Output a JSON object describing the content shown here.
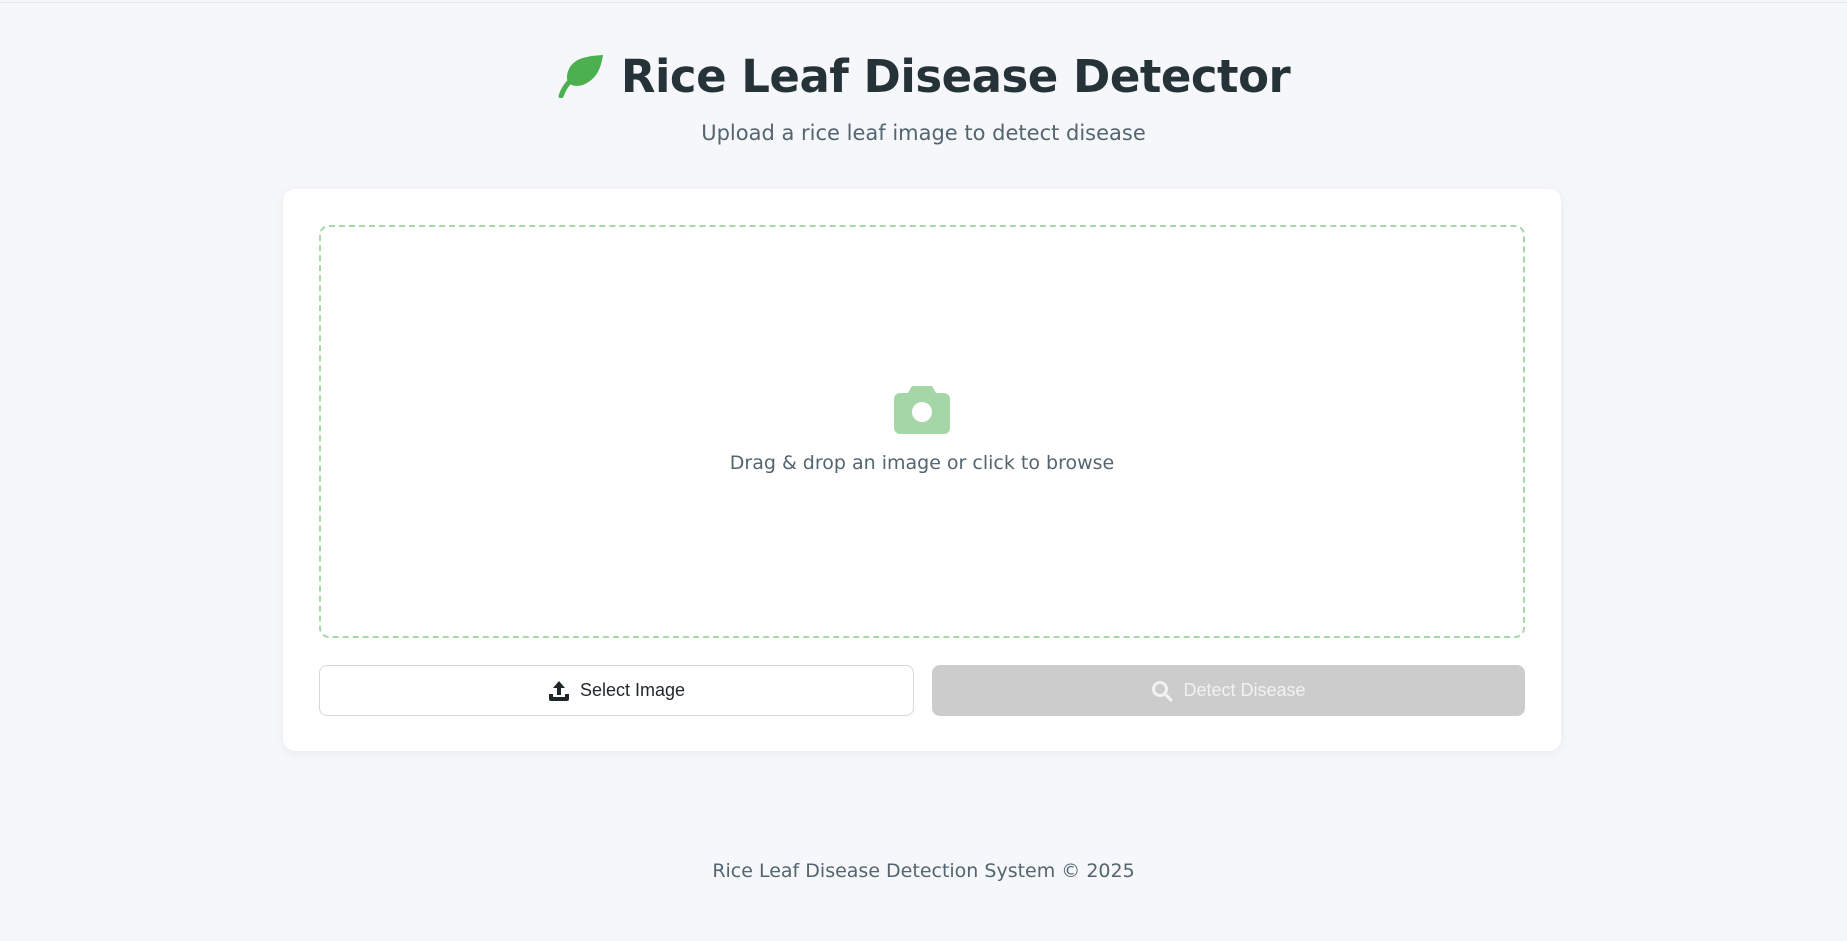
{
  "header": {
    "logo_icon": "leaf-icon",
    "title": "Rice Leaf Disease Detector",
    "subtitle": "Upload a rice leaf image to detect disease"
  },
  "upload": {
    "icon": "camera-icon",
    "drop_text": "Drag & drop an image or click to browse"
  },
  "buttons": {
    "select_label": "Select Image",
    "select_icon": "upload-icon",
    "detect_label": "Detect Disease",
    "detect_icon": "search-icon",
    "detect_disabled": true
  },
  "footer": {
    "text": "Rice Leaf Disease Detection System © 2025"
  },
  "colors": {
    "accent": "#4caf50",
    "accent_light": "#a5d6a7",
    "title": "#253238",
    "muted": "#54656f",
    "disabled": "#cccccc"
  }
}
